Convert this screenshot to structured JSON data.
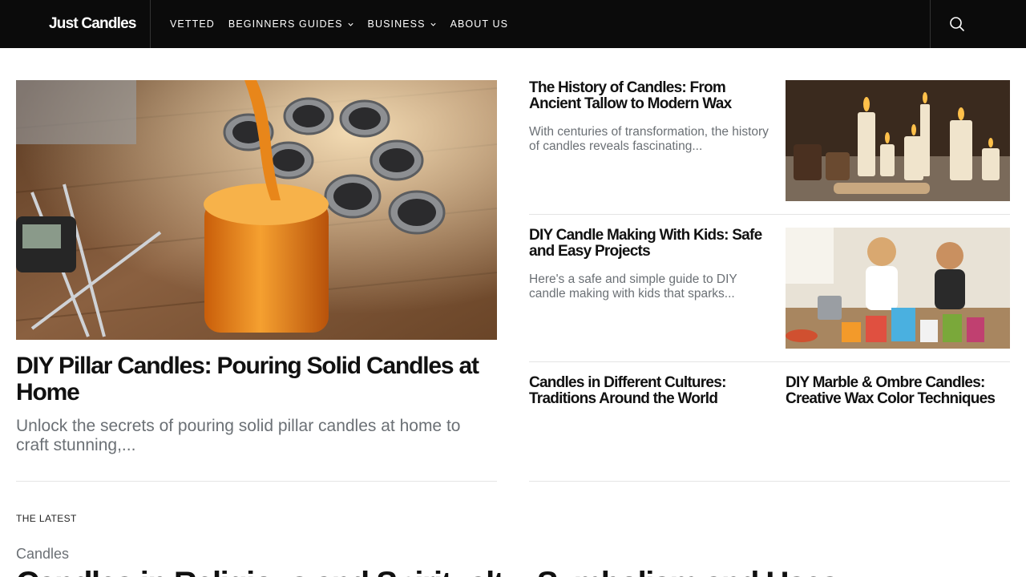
{
  "header": {
    "logo": "Just Candles",
    "nav": [
      {
        "label": "VETTED",
        "has_dropdown": false
      },
      {
        "label": "BEGINNERS GUIDES",
        "has_dropdown": true
      },
      {
        "label": "BUSINESS",
        "has_dropdown": true
      },
      {
        "label": "ABOUT US",
        "has_dropdown": false
      }
    ],
    "search_icon": "search-icon",
    "background": "#0b0b0b"
  },
  "hero": {
    "image_icon": "candle-pouring-image",
    "title": "DIY Pillar Candles: Pouring Solid Candles at Home",
    "excerpt": "Unlock the secrets of pouring solid pillar candles at home to craft stunning,..."
  },
  "cards": [
    {
      "title": "The History of Candles: From Ancient Tallow to Modern Wax",
      "excerpt": "With centuries of transformation, the history of candles reveals fascinating...",
      "image_icon": "candles-history-image"
    },
    {
      "title": "DIY Candle Making With Kids: Safe and Easy Projects",
      "excerpt": "Here's a safe and simple guide to DIY candle making with kids that sparks...",
      "image_icon": "kids-candle-making-image"
    }
  ],
  "mini_cards": [
    {
      "title": "Candles in Different Cultures: Traditions Around the World"
    },
    {
      "title": "DIY Marble & Ombre Candles: Creative Wax Color Techniques"
    }
  ],
  "latest": {
    "label": "THE LATEST",
    "category": "Candles",
    "title": "Candles in Religious and Spiritualty: Symbolism and Uses"
  },
  "colors": {
    "accent_wax": "#e8861a",
    "text_muted": "#6b7075",
    "divider": "#e4e4e4"
  }
}
